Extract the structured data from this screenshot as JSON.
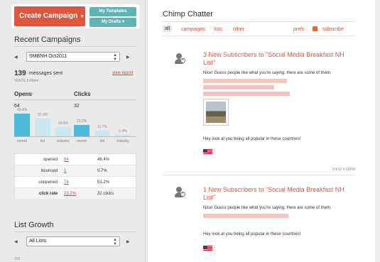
{
  "header": {
    "create_label": "Create Campaign",
    "create_caret": "▼",
    "templates_label": "My Templates",
    "drafts_label": "My Drafts ▾"
  },
  "recent": {
    "title": "Recent Campaigns",
    "prev": "◀",
    "next": "▶",
    "selected_campaign": "SMBNH Oct2011",
    "messages_sent": "139",
    "messages_sent_label": "messages sent",
    "view_report": "view report",
    "sent_date": "10/5/11 6:06am",
    "opens_label": "Opens",
    "opens_count": "64",
    "clicks_label": "Clicks",
    "clicks_count": "32",
    "opens_bars": [
      {
        "label": "recent",
        "pct": 46.4,
        "pct_text": "46.4%",
        "color": "#4ab8d8"
      },
      {
        "label": "list",
        "pct": 37.3,
        "pct_text": "37.3%",
        "color": "#c9e8f1"
      },
      {
        "label": "industry",
        "pct": 19.8,
        "pct_text": "19.8%",
        "color": "#c9e8f1"
      }
    ],
    "clicks_bars": [
      {
        "label": "recent",
        "pct": 23.2,
        "pct_text": "23.2%",
        "color": "#4ab8d8"
      },
      {
        "label": "list",
        "pct": 11.7,
        "pct_text": "11.7%",
        "color": "#c9e8f1"
      },
      {
        "label": "industry",
        "pct": 3.4,
        "pct_text": "3.4%",
        "color": "#c9e8f1"
      }
    ],
    "table": [
      {
        "label": "opened",
        "link": "64",
        "value": "46.4%"
      },
      {
        "label": "bounced",
        "link": "1",
        "value": "0.7%"
      },
      {
        "label": "unopened",
        "link": "74",
        "value": "53.2%"
      },
      {
        "label": "click rate",
        "link": "23.2%",
        "value": "32 clicks"
      }
    ]
  },
  "growth": {
    "title": "List Growth",
    "selected_list": "All Lists",
    "axis_top": "160"
  },
  "chatter": {
    "title": "Chimp Chatter",
    "filters": {
      "all": "all",
      "campaigns": "campaigns",
      "lists": "lists",
      "other": "other",
      "prefs": "prefs",
      "subscribe": "subscribe"
    },
    "posts": [
      {
        "title": "3 New Subscribers to \"Social Media Breakfast NH List\"",
        "intro": "Nice! Guess people like what you're saying. Here are some of them:",
        "countries_text": "Hey look at you being all popular in these countries!",
        "date": "1/4/12 5:00PM"
      },
      {
        "title": "1 New Subscribers to \"Social Media Breakfast NH List\"",
        "intro": "Nice! Guess people like what you're saying. Here are some of them:",
        "countries_text": "Hey look at you being all popular in these countries!"
      }
    ]
  },
  "colors": {
    "accent": "#e0553d",
    "teal": "#5fb3b3",
    "bar_primary": "#4ab8d8",
    "bar_light": "#c9e8f1"
  }
}
